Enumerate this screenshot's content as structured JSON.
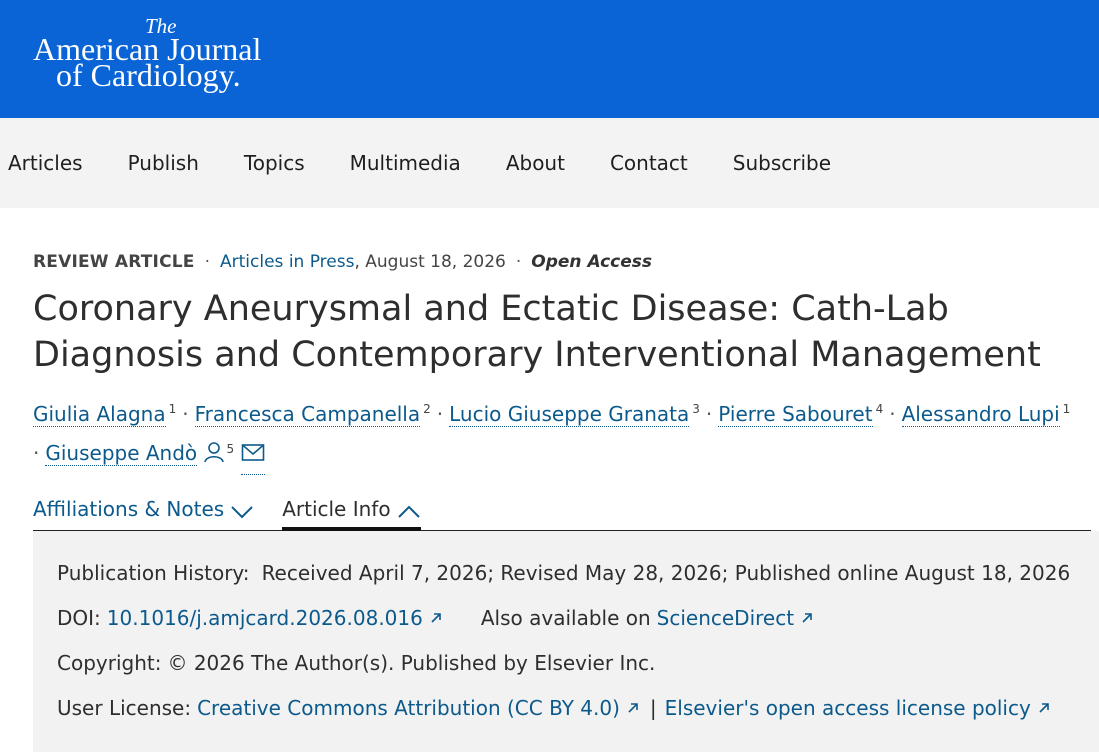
{
  "header": {
    "logo_the": "The",
    "logo_line1": "American Journal",
    "logo_line2": "of Cardiology."
  },
  "nav": {
    "items": [
      "Articles",
      "Publish",
      "Topics",
      "Multimedia",
      "About",
      "Contact",
      "Subscribe"
    ]
  },
  "meta": {
    "type": "REVIEW ARTICLE",
    "section": "Articles in Press",
    "date": ", August 18, 2026",
    "access": "Open Access"
  },
  "title": "Coronary Aneurysmal and Ectatic Disease: Cath-Lab Diagnosis and Contemporary Interventional Management",
  "authors": [
    {
      "name": "Giulia Alagna",
      "sup": "1"
    },
    {
      "name": "Francesca Campanella",
      "sup": "2"
    },
    {
      "name": "Lucio Giuseppe Granata",
      "sup": "3"
    },
    {
      "name": "Pierre Sabouret",
      "sup": "4"
    },
    {
      "name": "Alessandro Lupi",
      "sup": "1"
    },
    {
      "name": "Giuseppe Andò",
      "sup": "5"
    }
  ],
  "tabs": {
    "affiliations": "Affiliations & Notes",
    "article_info": "Article Info"
  },
  "info": {
    "history_label": "Publication History:",
    "history_value": "Received April 7, 2026; Revised May 28, 2026; Published online August 18, 2026",
    "doi_label": "DOI:",
    "doi_value": "10.1016/j.amjcard.2026.08.016",
    "also_label": "Also available on",
    "also_link": "ScienceDirect",
    "copyright_label": "Copyright:",
    "copyright_value": "© 2026 The Author(s). Published by Elsevier Inc.",
    "license_label": "User License:",
    "license_link1": "Creative Commons Attribution (CC BY 4.0)",
    "license_sep": "|",
    "license_link2": "Elsevier's open access license policy"
  },
  "colors": {
    "brand_blue": "#0a64d6",
    "link": "#0c5a8c",
    "panel_bg": "#f2f2f2",
    "nav_bg": "#f3f3f3"
  },
  "icons": [
    "person-icon",
    "envelope-icon",
    "chevron-down-icon",
    "chevron-up-icon",
    "external-link-icon"
  ]
}
